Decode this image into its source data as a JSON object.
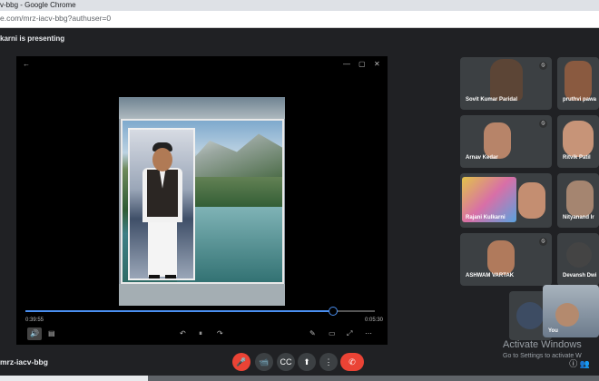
{
  "window": {
    "title": "v-bbg - Google Chrome"
  },
  "address_bar": {
    "url": "e.com/mrz-iacv-bbg?authuser=0"
  },
  "presenting_banner": "karni is presenting",
  "player": {
    "elapsed": "0:39:55",
    "duration": "0:05:30",
    "progress": 0.88,
    "window_controls": [
      "←",
      "—",
      "▢",
      "✕"
    ],
    "controls": {
      "left": [
        "🔊",
        "▤"
      ],
      "center": [
        "↶",
        "⏸",
        "↷"
      ],
      "right": [
        "✎",
        "▭",
        "⤢",
        "⋯"
      ]
    }
  },
  "participants": [
    {
      "name": "Sovit Kumar Paridal",
      "muted": true,
      "bg": "#3a3a3a"
    },
    {
      "name": "pruthvi pawa",
      "muted": false,
      "bg": "#5a3b2a"
    },
    {
      "name": "Arnav Kedar",
      "muted": true,
      "bg": "#c8637a"
    },
    {
      "name": "Ritvik Patil",
      "muted": false,
      "bg": "#d2c2b0"
    },
    {
      "name": "Rajani Kulkarni",
      "muted": false,
      "bg": "#7b5fb5"
    },
    {
      "name": "Nityanand Ir",
      "muted": false,
      "bg": "#c3c0be"
    },
    {
      "name": "ASHWAM VARTAK",
      "muted": true,
      "bg": "#8a7066"
    },
    {
      "name": "Devansh Dwi",
      "muted": false,
      "bg": "#2e2f31"
    },
    {
      "name": "You",
      "muted": false,
      "bg": "#6c7b8c"
    }
  ],
  "meeting_code": "mrz-iacv-bbg",
  "bottom_controls": [
    "🎤",
    "📹",
    "CC",
    "⬆",
    "⋮",
    "✆"
  ],
  "watermark": {
    "title": "Activate Windows",
    "subtitle": "Go to Settings to activate W"
  },
  "corner_icons": [
    "ⓘ",
    "👥"
  ]
}
